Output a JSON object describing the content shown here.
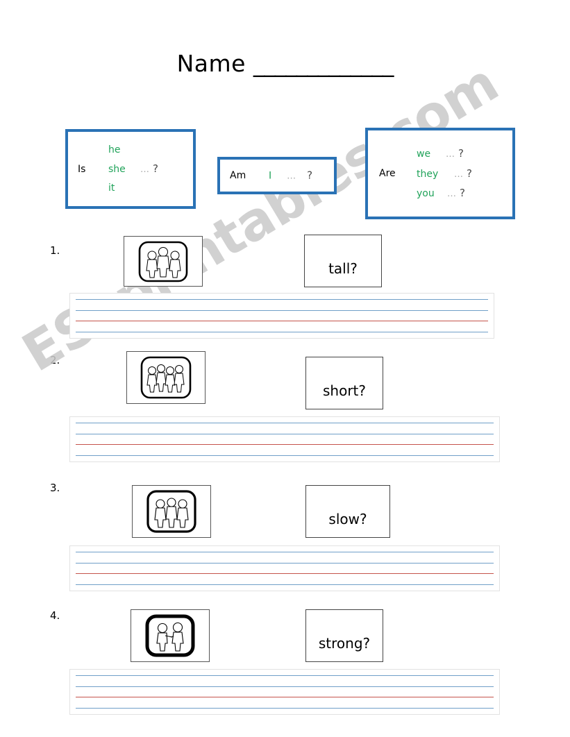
{
  "page": {
    "title_label": "Name",
    "title_blank": "_____________",
    "watermark": "ESLprintables.com"
  },
  "grammar_boxes": [
    {
      "name": "is-box",
      "verb": "Is",
      "rows": [
        {
          "pronoun": "he",
          "dots": "",
          "qmark": ""
        },
        {
          "pronoun": "she",
          "dots": "…",
          "qmark": "?"
        },
        {
          "pronoun": "it",
          "dots": "",
          "qmark": ""
        }
      ]
    },
    {
      "name": "am-box",
      "verb": "Am",
      "rows": [
        {
          "pronoun": "I",
          "dots": "…",
          "qmark": "?"
        }
      ]
    },
    {
      "name": "are-box",
      "verb": "Are",
      "rows": [
        {
          "pronoun": "we",
          "dots": "…",
          "qmark": "?"
        },
        {
          "pronoun": "they",
          "dots": "…",
          "qmark": "?"
        },
        {
          "pronoun": "you",
          "dots": "…",
          "qmark": "?"
        }
      ]
    }
  ],
  "questions": [
    {
      "number": "1.",
      "word": "tall?",
      "picture": "three-children-standing-icon",
      "picture_people": 3,
      "picture_border": "thin"
    },
    {
      "number": "2.",
      "word": "short?",
      "picture": "four-children-standing-icon",
      "picture_people": 4,
      "picture_border": "thin"
    },
    {
      "number": "3.",
      "word": "slow?",
      "picture": "three-children-group-icon",
      "picture_people": 3,
      "picture_border": "medium"
    },
    {
      "number": "4.",
      "word": "strong?",
      "picture": "two-children-shaking-hands-icon",
      "picture_people": 2,
      "picture_border": "thick"
    }
  ],
  "writing_lines": {
    "line_colors": [
      "#6f9fc8",
      "#6f9fc8",
      "#c5534b",
      "#6f9fc8"
    ]
  },
  "colors": {
    "box_border_blue": "#2a72b5",
    "pronoun_green": "#21a35a",
    "dots_gray": "#a8a8a8",
    "line_blue": "#6f9fc8",
    "line_red": "#c5534b",
    "watermark_gray": "#c9c9c9"
  }
}
